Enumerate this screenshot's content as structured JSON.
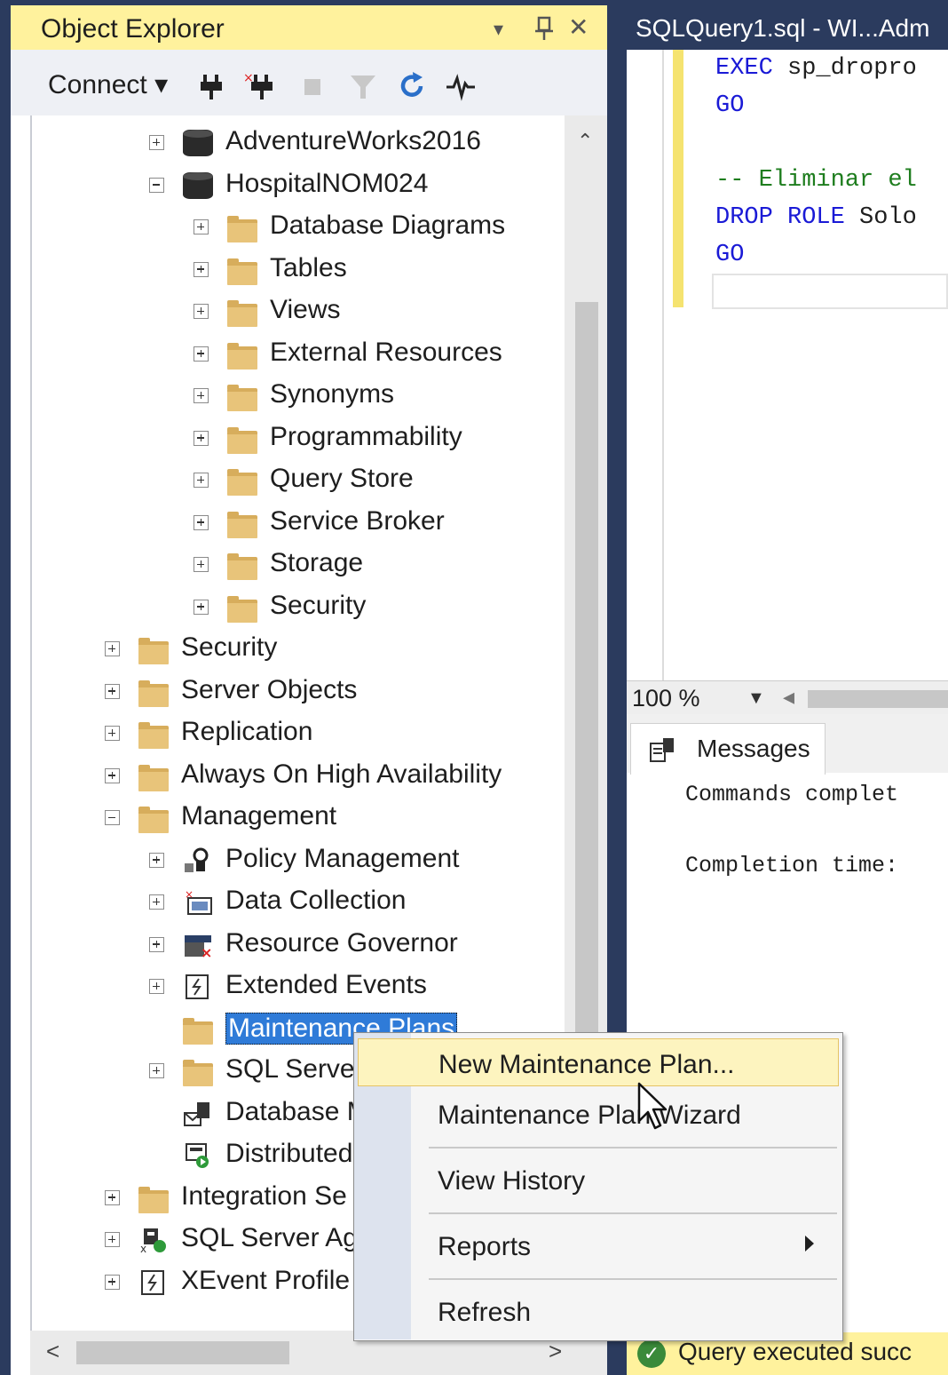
{
  "object_explorer": {
    "title": "Object Explorer",
    "title_controls": [
      "▾",
      "ꟷ",
      "✕"
    ],
    "toolbar": {
      "connect_label": "Connect ▾"
    },
    "tree": [
      {
        "label": "AdventureWorks2016",
        "expander": "plus",
        "icon": "database-icon"
      },
      {
        "label": "HospitalNOM024",
        "expander": "minus",
        "icon": "database-icon"
      },
      {
        "label": "Database Diagrams",
        "expander": "plus",
        "icon": "folder-icon"
      },
      {
        "label": "Tables",
        "expander": "plus",
        "icon": "folder-icon"
      },
      {
        "label": "Views",
        "expander": "plus",
        "icon": "folder-icon"
      },
      {
        "label": "External Resources",
        "expander": "plus",
        "icon": "folder-icon"
      },
      {
        "label": "Synonyms",
        "expander": "plus",
        "icon": "folder-icon"
      },
      {
        "label": "Programmability",
        "expander": "plus",
        "icon": "folder-icon"
      },
      {
        "label": "Query Store",
        "expander": "plus",
        "icon": "folder-icon"
      },
      {
        "label": "Service Broker",
        "expander": "plus",
        "icon": "folder-icon"
      },
      {
        "label": "Storage",
        "expander": "plus",
        "icon": "folder-icon"
      },
      {
        "label": "Security",
        "expander": "plus",
        "icon": "folder-icon"
      },
      {
        "label": "Security",
        "expander": "plus",
        "icon": "folder-icon"
      },
      {
        "label": "Server Objects",
        "expander": "plus",
        "icon": "folder-icon"
      },
      {
        "label": "Replication",
        "expander": "plus",
        "icon": "folder-icon"
      },
      {
        "label": "Always On High Availability",
        "expander": "plus",
        "icon": "folder-icon"
      },
      {
        "label": "Management",
        "expander": "minus",
        "icon": "folder-icon"
      },
      {
        "label": "Policy Management",
        "expander": "plus",
        "icon": "policy-icon"
      },
      {
        "label": "Data Collection",
        "expander": "plus",
        "icon": "data-collection-icon"
      },
      {
        "label": "Resource Governor",
        "expander": "plus",
        "icon": "resource-governor-icon"
      },
      {
        "label": "Extended Events",
        "expander": "plus",
        "icon": "extended-events-icon"
      },
      {
        "label": "Maintenance Plans",
        "expander": "none",
        "icon": "folder-icon",
        "selected": true
      },
      {
        "label": "SQL Server",
        "expander": "plus",
        "icon": "folder-icon"
      },
      {
        "label": "Database M",
        "expander": "none",
        "icon": "database-mail-icon"
      },
      {
        "label": "Distributed",
        "expander": "none",
        "icon": "distributed-icon"
      },
      {
        "label": "Integration Se",
        "expander": "plus",
        "icon": "folder-icon"
      },
      {
        "label": "SQL Server Ag",
        "expander": "plus",
        "icon": "sql-agent-icon"
      },
      {
        "label": "XEvent Profile",
        "expander": "plus",
        "icon": "xevent-icon"
      }
    ]
  },
  "query_editor": {
    "tab_title": "SQLQuery1.sql - WI...Adm",
    "code_lines": [
      {
        "kw": "EXEC",
        "rest": " sp_dropro"
      },
      {
        "kw": "GO",
        "rest": ""
      },
      {
        "kw": "",
        "rest": ""
      },
      {
        "kw": "-- Eliminar el",
        "rest": "",
        "comment": true
      },
      {
        "kw": "DROP ROLE",
        "rest": " Solo"
      },
      {
        "kw": "GO",
        "rest": ""
      }
    ],
    "zoom": "100 %",
    "results_tab": "Messages",
    "messages": [
      "Commands complet",
      "Completion time:"
    ],
    "status": "Query executed succ"
  },
  "context_menu": {
    "items": [
      {
        "label": "New Maintenance Plan...",
        "highlighted": true
      },
      {
        "label": "Maintenance Plan Wizard"
      },
      {
        "label": "View History"
      },
      {
        "label": "Reports",
        "submenu": true
      },
      {
        "label": "Refresh"
      }
    ]
  },
  "colors": {
    "title_bar": "#fff29d",
    "selection": "#2f7bd8",
    "menu_highlight": "#fdf4bf",
    "keyword": "#1a1ad6",
    "comment": "#1e7d1e"
  }
}
